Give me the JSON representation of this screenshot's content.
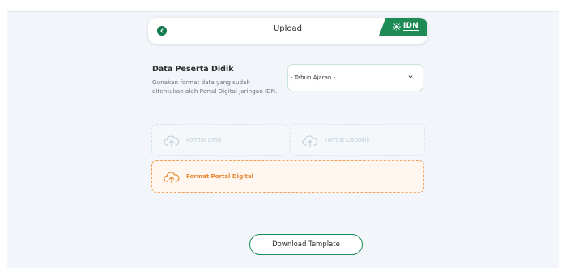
{
  "header": {
    "title": "Upload",
    "logo_text": "IDN",
    "back_icon": "chevron-left-icon"
  },
  "section": {
    "title": "Data Peserta Didik",
    "description": "Gunakan format data yang sudah ditentukan oleh Portal Digital Jaringan IDN."
  },
  "year_select": {
    "value": "- Tahun Ajaran -",
    "icon": "chevron-down-icon"
  },
  "formats": [
    {
      "label": "Format Emis",
      "icon": "cloud-upload-icon",
      "state": "disabled"
    },
    {
      "label": "Format Dapodik",
      "icon": "cloud-upload-icon",
      "state": "disabled"
    },
    {
      "label": "Format Portal Digital",
      "icon": "cloud-upload-icon",
      "state": "active"
    }
  ],
  "actions": {
    "download_label": "Download Template"
  },
  "colors": {
    "brand_green": "#1e8b55",
    "accent_orange": "#e6872f",
    "disabled_text": "#c3d0d8",
    "background": "#f2f5f9"
  }
}
